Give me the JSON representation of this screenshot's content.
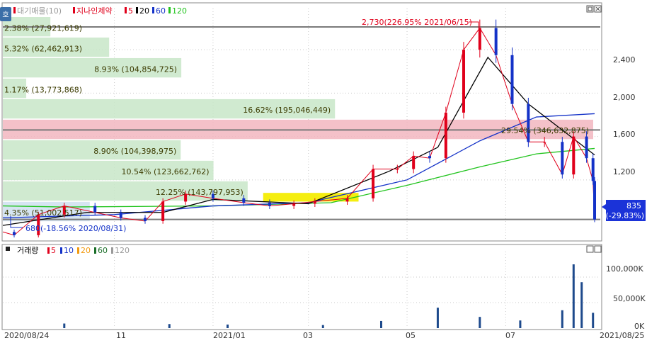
{
  "colors": {
    "up": "#e0001b",
    "down": "#1432c8",
    "ma5": "#e0001b",
    "ma20": "#000000",
    "ma60": "#1432c8",
    "ma120": "#22c41e",
    "profile_bar": "#c8e6c8",
    "profile_bar_high": "#f2b6c0",
    "profile_bar_low": "#cfe0f0",
    "highlight_band": "#f5ee10",
    "hline": "#7a7a7a",
    "price_tag": "#0000ff",
    "grid": "#c9c9c9"
  },
  "price_panel": {
    "legend": {
      "label_volume_profile": "대기매물(10)",
      "label_stock": "지나인제약",
      "ma_labels": [
        "5",
        "20",
        "60",
        "120"
      ]
    },
    "side_button": "호",
    "y_ticks": [
      "2,400",
      "2,000",
      "1,600",
      "1,200"
    ],
    "high_annotation": "2,730(226.95% 2021/06/15)",
    "low_annotation": "680(-18.56% 2020/08/31)",
    "current_price": "835",
    "current_change": "(-29.83%)",
    "volume_profile": [
      {
        "text": "2.38% (27,921,619)",
        "pct": 2.38
      },
      {
        "text": "5.32% (62,462,913)",
        "pct": 5.32
      },
      {
        "text": "8.93% (104,854,725)",
        "pct": 8.93
      },
      {
        "text": "1.17% (13,773,868)",
        "pct": 1.17
      },
      {
        "text": "16.62% (195,046,449)",
        "pct": 16.62
      },
      {
        "text": "29.54% (346,632,875)",
        "pct": 29.54
      },
      {
        "text": "8.90% (104,398,975)",
        "pct": 8.9
      },
      {
        "text": "10.54% (123,662,762)",
        "pct": 10.54
      },
      {
        "text": "12.25% (143,797,953)",
        "pct": 12.25
      },
      {
        "text": "4.35% (51,002,517)",
        "pct": 4.35
      }
    ]
  },
  "volume_panel": {
    "legend": {
      "label": "거래량",
      "ma_labels": [
        "5",
        "10",
        "20",
        "60",
        "120"
      ]
    },
    "y_ticks": [
      "100,000K",
      "50,000K",
      "0K"
    ]
  },
  "x_axis": {
    "labels": [
      "2020/08/24",
      "11",
      "2021/01",
      "03",
      "05",
      "07",
      "2021/08/25"
    ]
  },
  "chart_data": {
    "type": "candlestick",
    "title": "지나인제약",
    "ylim": [
      650,
      2780
    ],
    "volume_ylim": [
      0,
      150000
    ],
    "y_reference_lines": [
      2610,
      1660,
      835
    ],
    "highlight_band_range": [
      1000,
      1080
    ],
    "key_points": {
      "high": {
        "date": "2021/06/15",
        "price": 2730
      },
      "low": {
        "date": "2020/08/31",
        "price": 680
      },
      "last": {
        "date": "2021/08/25",
        "price": 835,
        "change_pct": -29.83
      }
    },
    "price_series": [
      {
        "date": "2020/08/24",
        "close": 720
      },
      {
        "date": "2020/08/31",
        "close": 690
      },
      {
        "date": "2020/09/15",
        "close": 880
      },
      {
        "date": "2020/10/01",
        "close": 960
      },
      {
        "date": "2020/10/20",
        "close": 900
      },
      {
        "date": "2020/11/05",
        "close": 850
      },
      {
        "date": "2020/11/20",
        "close": 820
      },
      {
        "date": "2020/12/01",
        "close": 1000
      },
      {
        "date": "2020/12/15",
        "close": 1070
      },
      {
        "date": "2021/01/01",
        "close": 1030
      },
      {
        "date": "2021/01/20",
        "close": 990
      },
      {
        "date": "2021/02/05",
        "close": 960
      },
      {
        "date": "2021/02/20",
        "close": 980
      },
      {
        "date": "2021/03/05",
        "close": 1000
      },
      {
        "date": "2021/03/25",
        "close": 1030
      },
      {
        "date": "2021/04/10",
        "close": 1300
      },
      {
        "date": "2021/04/25",
        "close": 1300
      },
      {
        "date": "2021/05/05",
        "close": 1420
      },
      {
        "date": "2021/05/15",
        "close": 1400
      },
      {
        "date": "2021/05/25",
        "close": 1820
      },
      {
        "date": "2021/06/05",
        "close": 2400
      },
      {
        "date": "2021/06/15",
        "close": 2600
      },
      {
        "date": "2021/06/25",
        "close": 2350
      },
      {
        "date": "2021/07/05",
        "close": 1900
      },
      {
        "date": "2021/07/15",
        "close": 1550
      },
      {
        "date": "2021/07/25",
        "close": 1550
      },
      {
        "date": "2021/08/05",
        "close": 1250
      },
      {
        "date": "2021/08/12",
        "close": 1600
      },
      {
        "date": "2021/08/20",
        "close": 1400
      },
      {
        "date": "2021/08/24",
        "close": 1190
      },
      {
        "date": "2021/08/25",
        "close": 835
      }
    ],
    "ma20_series": [
      {
        "date": "2020/08/24",
        "value": 780
      },
      {
        "date": "2020/10/15",
        "value": 900
      },
      {
        "date": "2020/12/01",
        "value": 900
      },
      {
        "date": "2021/01/01",
        "value": 1020
      },
      {
        "date": "2021/03/01",
        "value": 980
      },
      {
        "date": "2021/04/20",
        "value": 1280
      },
      {
        "date": "2021/05/20",
        "value": 1500
      },
      {
        "date": "2021/06/20",
        "value": 2330
      },
      {
        "date": "2021/07/15",
        "value": 1900
      },
      {
        "date": "2021/08/25",
        "value": 1430
      }
    ],
    "ma60_series": [
      {
        "date": "2020/08/24",
        "value": 850
      },
      {
        "date": "2020/11/01",
        "value": 880
      },
      {
        "date": "2021/01/01",
        "value": 960
      },
      {
        "date": "2021/03/01",
        "value": 990
      },
      {
        "date": "2021/05/01",
        "value": 1200
      },
      {
        "date": "2021/06/15",
        "value": 1560
      },
      {
        "date": "2021/07/20",
        "value": 1780
      },
      {
        "date": "2021/08/25",
        "value": 1810
      }
    ],
    "ma120_series": [
      {
        "date": "2020/08/24",
        "value": 960
      },
      {
        "date": "2020/10/01",
        "value": 950
      },
      {
        "date": "2021/01/01",
        "value": 960
      },
      {
        "date": "2021/03/15",
        "value": 990
      },
      {
        "date": "2021/05/01",
        "value": 1150
      },
      {
        "date": "2021/06/15",
        "value": 1320
      },
      {
        "date": "2021/07/20",
        "value": 1440
      },
      {
        "date": "2021/08/25",
        "value": 1490
      }
    ],
    "volume_series": [
      {
        "date": "2020/10/01",
        "value": 9000
      },
      {
        "date": "2020/12/05",
        "value": 8000
      },
      {
        "date": "2021/01/10",
        "value": 7000
      },
      {
        "date": "2021/03/10",
        "value": 6000
      },
      {
        "date": "2021/04/15",
        "value": 14000
      },
      {
        "date": "2021/05/20",
        "value": 40000
      },
      {
        "date": "2021/06/15",
        "value": 22000
      },
      {
        "date": "2021/07/10",
        "value": 15000
      },
      {
        "date": "2021/08/05",
        "value": 35000
      },
      {
        "date": "2021/08/12",
        "value": 125000
      },
      {
        "date": "2021/08/17",
        "value": 90000
      },
      {
        "date": "2021/08/24",
        "value": 30000
      }
    ]
  }
}
